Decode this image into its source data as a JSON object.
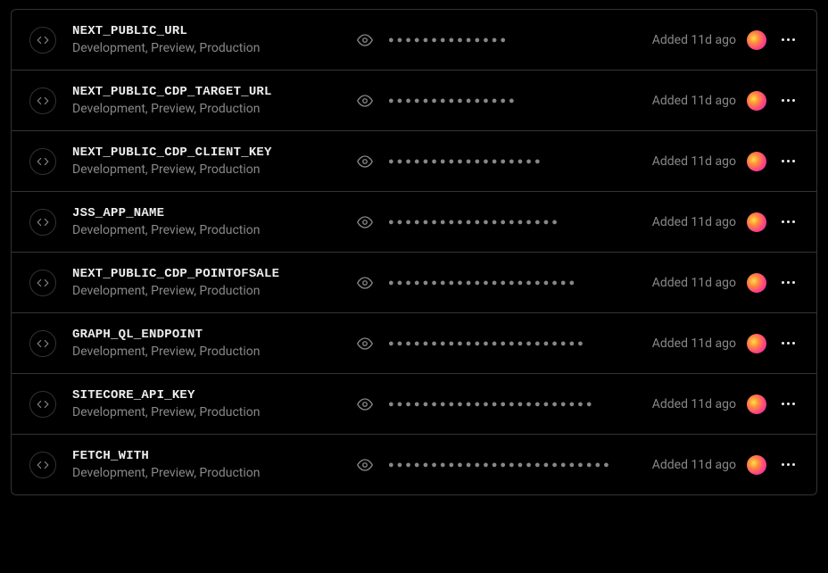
{
  "rows": [
    {
      "name": "NEXT_PUBLIC_URL",
      "envs": "Development, Preview, Production",
      "masked": "●●●●●●●●●●●●●●",
      "added": "Added 11d ago"
    },
    {
      "name": "NEXT_PUBLIC_CDP_TARGET_URL",
      "envs": "Development, Preview, Production",
      "masked": "●●●●●●●●●●●●●●●",
      "added": "Added 11d ago"
    },
    {
      "name": "NEXT_PUBLIC_CDP_CLIENT_KEY",
      "envs": "Development, Preview, Production",
      "masked": "●●●●●●●●●●●●●●●●●●",
      "added": "Added 11d ago"
    },
    {
      "name": "JSS_APP_NAME",
      "envs": "Development, Preview, Production",
      "masked": "●●●●●●●●●●●●●●●●●●●●",
      "added": "Added 11d ago"
    },
    {
      "name": "NEXT_PUBLIC_CDP_POINTOFSALE",
      "envs": "Development, Preview, Production",
      "masked": "●●●●●●●●●●●●●●●●●●●●●●",
      "added": "Added 11d ago"
    },
    {
      "name": "GRAPH_QL_ENDPOINT",
      "envs": "Development, Preview, Production",
      "masked": "●●●●●●●●●●●●●●●●●●●●●●●",
      "added": "Added 11d ago"
    },
    {
      "name": "SITECORE_API_KEY",
      "envs": "Development, Preview, Production",
      "masked": "●●●●●●●●●●●●●●●●●●●●●●●●",
      "added": "Added 11d ago"
    },
    {
      "name": "FETCH_WITH",
      "envs": "Development, Preview, Production",
      "masked": "●●●●●●●●●●●●●●●●●●●●●●●●●●",
      "added": "Added 11d ago"
    }
  ]
}
